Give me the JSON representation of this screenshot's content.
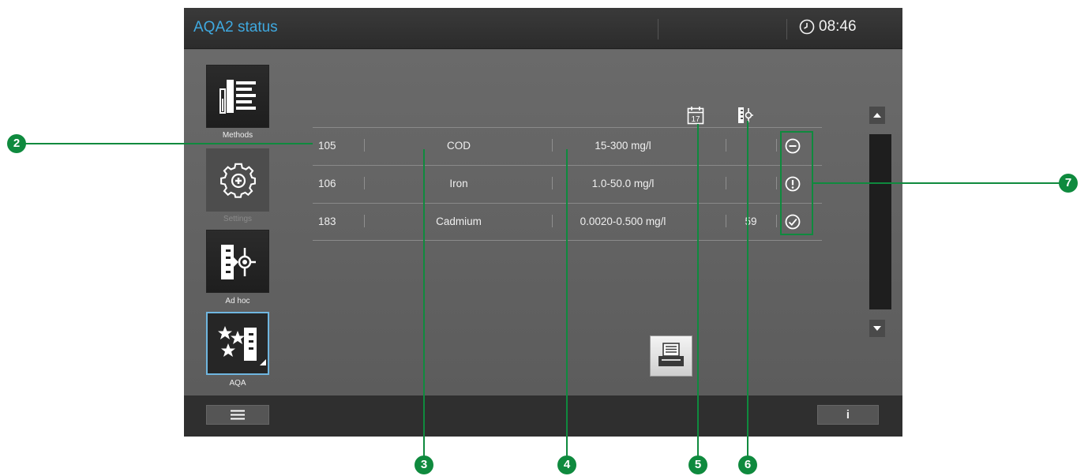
{
  "header": {
    "title": "AQA2 status",
    "time": "08:46",
    "clock_icon": "clock-icon"
  },
  "sidebar": {
    "items": [
      {
        "label": "Methods",
        "icon": "methods-list-icon"
      },
      {
        "label": "Settings",
        "icon": "gear-icon"
      },
      {
        "label": "Ad hoc",
        "icon": "ad-hoc-icon"
      },
      {
        "label": "AQA",
        "icon": "aqa-stars-icon"
      }
    ]
  },
  "table": {
    "header_icons": [
      "calendar-17-icon",
      "standard-measurement-icon"
    ],
    "calendar_day": "17",
    "rows": [
      {
        "number": "105",
        "parameter": "COD",
        "range": "15-300 mg/l",
        "days": "",
        "count": "",
        "status": "minus-circle-icon"
      },
      {
        "number": "106",
        "parameter": "Iron",
        "range": "1.0-50.0 mg/l",
        "days": "",
        "count": "",
        "status": "exclamation-circle-icon"
      },
      {
        "number": "183",
        "parameter": "Cadmium",
        "range": "0.0020-0.500 mg/l",
        "days": "",
        "count": "59",
        "status": "check-circle-icon"
      }
    ]
  },
  "buttons": {
    "print": "print-icon",
    "menu": "menu-icon",
    "info": "i"
  },
  "callouts": [
    "2",
    "3",
    "4",
    "5",
    "6",
    "7"
  ],
  "colors": {
    "title_blue": "#3fa9e0",
    "callout_green": "#0f8a3e",
    "screen_gray": "#595959",
    "titlebar": "#2f2f2f"
  }
}
